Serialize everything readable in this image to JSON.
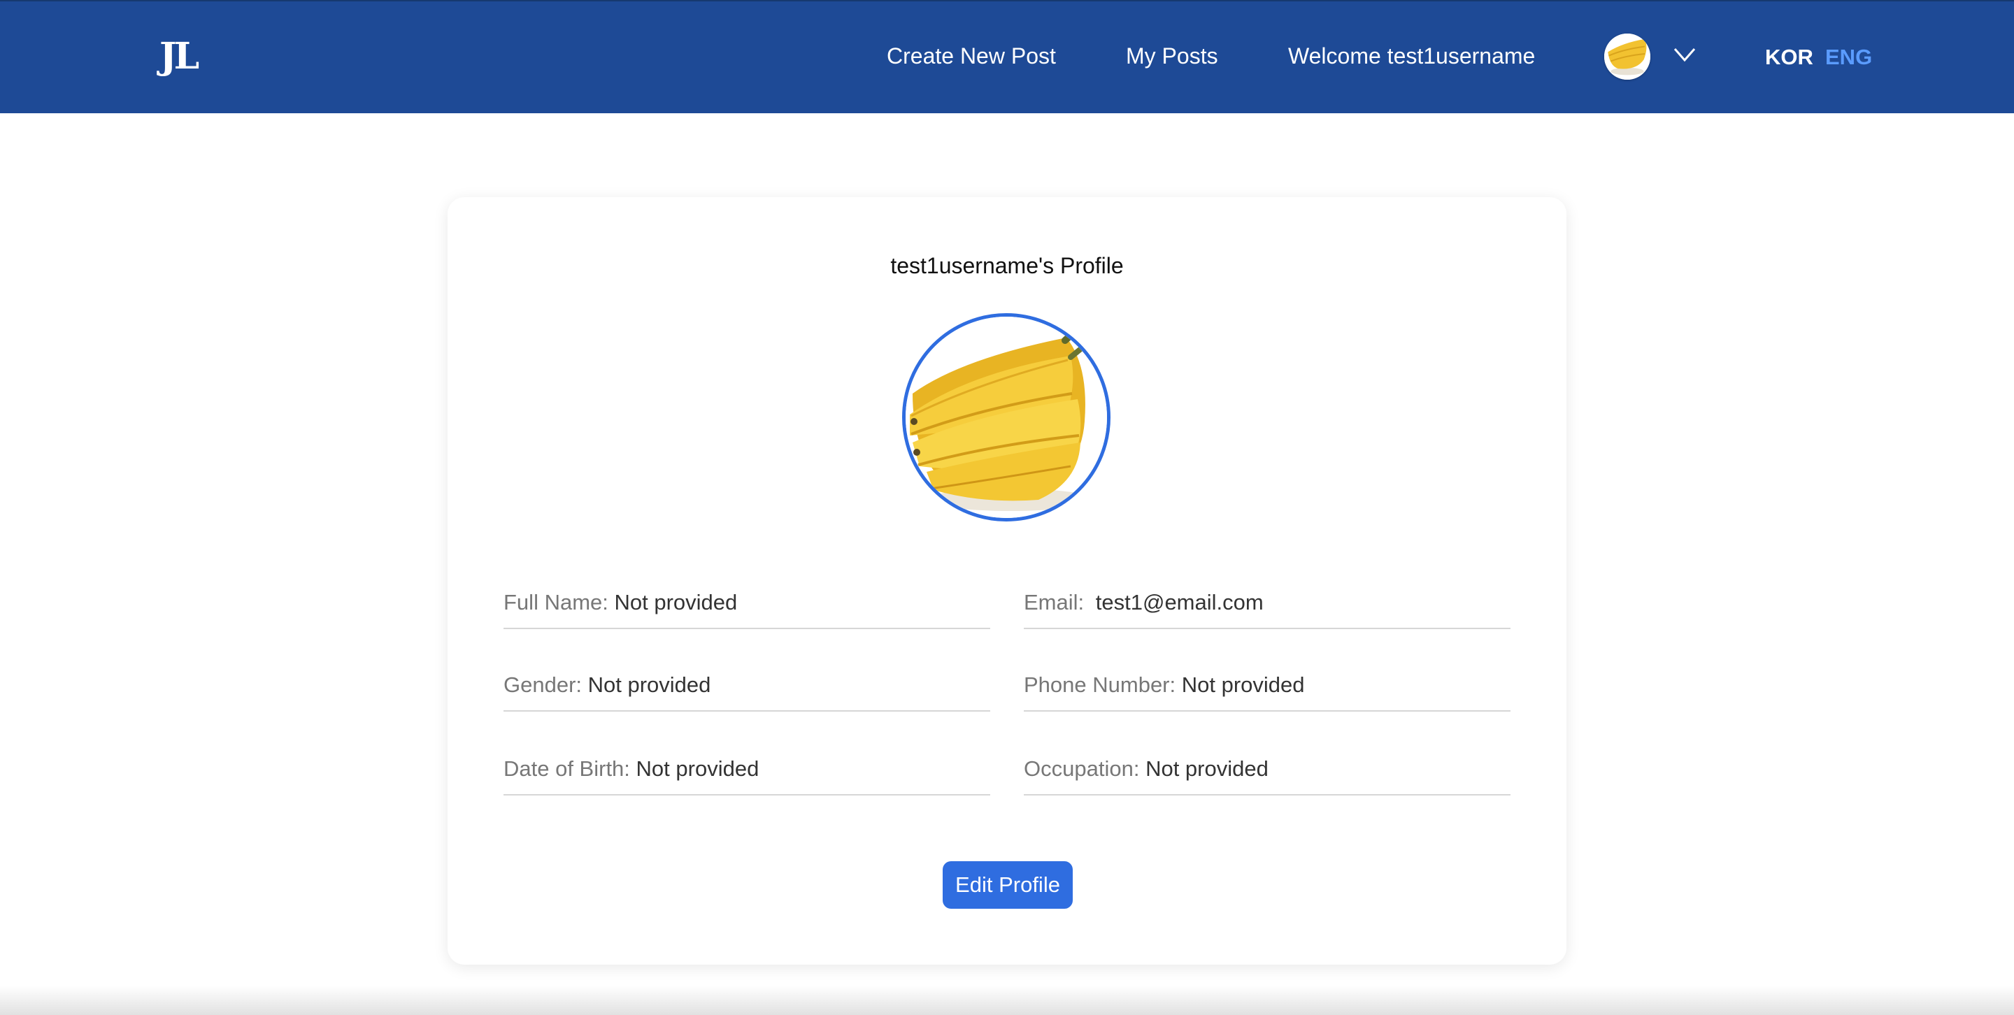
{
  "header": {
    "logo": "JL",
    "nav": {
      "create_post": "Create New Post",
      "my_posts": "My Posts",
      "welcome": "Welcome test1username"
    },
    "avatar_icon": "banana-avatar-icon",
    "dropdown_icon": "chevron-down-icon",
    "languages": {
      "kor": "KOR",
      "eng": "ENG",
      "active": "ENG"
    }
  },
  "profile": {
    "title": "test1username's Profile",
    "avatar_icon": "banana-avatar-icon",
    "fields": {
      "full_name": {
        "label": "Full Name:",
        "value": "Not provided"
      },
      "email": {
        "label": "Email:",
        "value": "test1@email.com"
      },
      "gender": {
        "label": "Gender:",
        "value": "Not provided"
      },
      "phone": {
        "label": "Phone Number:",
        "value": "Not provided"
      },
      "dob": {
        "label": "Date of Birth:",
        "value": "Not provided"
      },
      "occupation": {
        "label": "Occupation:",
        "value": "Not provided"
      }
    },
    "edit_button": "Edit Profile"
  },
  "colors": {
    "navbar": "#1e4a96",
    "accent": "#2f6de0",
    "active_language": "#5b9cff"
  }
}
